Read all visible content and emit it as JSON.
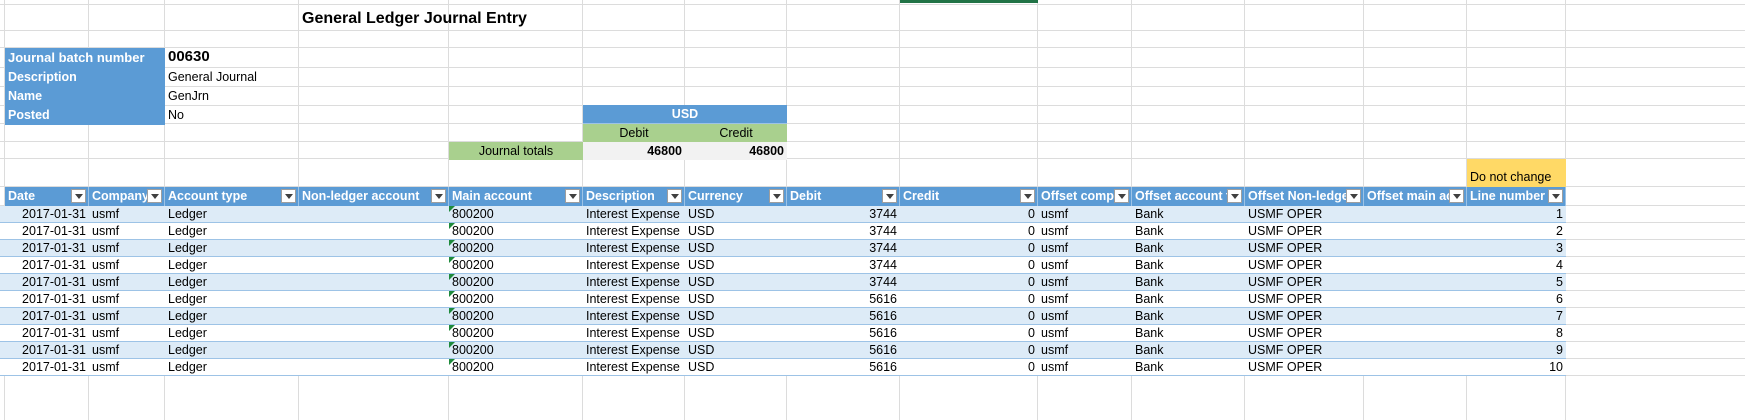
{
  "title": "General Ledger Journal Entry",
  "info": {
    "batch_label": "Journal batch number",
    "batch_value": "00630",
    "description_label": "Description",
    "description_value": "General Journal",
    "name_label": "Name",
    "name_value": "GenJrn",
    "posted_label": "Posted",
    "posted_value": "No"
  },
  "totals": {
    "currency": "USD",
    "debit_label": "Debit",
    "credit_label": "Credit",
    "row_label": "Journal totals",
    "debit_total": "46800",
    "credit_total": "46800"
  },
  "note": "Do not change",
  "columns": [
    "Date",
    "Company",
    "Account type",
    "Non-ledger account",
    "Main account",
    "Description",
    "Currency",
    "Debit",
    "Credit",
    "Offset compa",
    "Offset account ty",
    "Offset Non-ledger",
    "Offset main acc",
    "Line number"
  ],
  "rows": [
    {
      "date": "2017-01-31",
      "company": "usmf",
      "account_type": "Ledger",
      "non_ledger": "",
      "main_account": "800200",
      "description": "Interest Expense",
      "currency": "USD",
      "debit": "3744",
      "credit": "0",
      "offset_company": "usmf",
      "offset_type": "Bank",
      "offset_nonledger": "USMF OPER",
      "offset_main": "",
      "line": "1"
    },
    {
      "date": "2017-01-31",
      "company": "usmf",
      "account_type": "Ledger",
      "non_ledger": "",
      "main_account": "800200",
      "description": "Interest Expense",
      "currency": "USD",
      "debit": "3744",
      "credit": "0",
      "offset_company": "usmf",
      "offset_type": "Bank",
      "offset_nonledger": "USMF OPER",
      "offset_main": "",
      "line": "2"
    },
    {
      "date": "2017-01-31",
      "company": "usmf",
      "account_type": "Ledger",
      "non_ledger": "",
      "main_account": "800200",
      "description": "Interest Expense",
      "currency": "USD",
      "debit": "3744",
      "credit": "0",
      "offset_company": "usmf",
      "offset_type": "Bank",
      "offset_nonledger": "USMF OPER",
      "offset_main": "",
      "line": "3"
    },
    {
      "date": "2017-01-31",
      "company": "usmf",
      "account_type": "Ledger",
      "non_ledger": "",
      "main_account": "800200",
      "description": "Interest Expense",
      "currency": "USD",
      "debit": "3744",
      "credit": "0",
      "offset_company": "usmf",
      "offset_type": "Bank",
      "offset_nonledger": "USMF OPER",
      "offset_main": "",
      "line": "4"
    },
    {
      "date": "2017-01-31",
      "company": "usmf",
      "account_type": "Ledger",
      "non_ledger": "",
      "main_account": "800200",
      "description": "Interest Expense",
      "currency": "USD",
      "debit": "3744",
      "credit": "0",
      "offset_company": "usmf",
      "offset_type": "Bank",
      "offset_nonledger": "USMF OPER",
      "offset_main": "",
      "line": "5"
    },
    {
      "date": "2017-01-31",
      "company": "usmf",
      "account_type": "Ledger",
      "non_ledger": "",
      "main_account": "800200",
      "description": "Interest Expense",
      "currency": "USD",
      "debit": "5616",
      "credit": "0",
      "offset_company": "usmf",
      "offset_type": "Bank",
      "offset_nonledger": "USMF OPER",
      "offset_main": "",
      "line": "6"
    },
    {
      "date": "2017-01-31",
      "company": "usmf",
      "account_type": "Ledger",
      "non_ledger": "",
      "main_account": "800200",
      "description": "Interest Expense",
      "currency": "USD",
      "debit": "5616",
      "credit": "0",
      "offset_company": "usmf",
      "offset_type": "Bank",
      "offset_nonledger": "USMF OPER",
      "offset_main": "",
      "line": "7"
    },
    {
      "date": "2017-01-31",
      "company": "usmf",
      "account_type": "Ledger",
      "non_ledger": "",
      "main_account": "800200",
      "description": "Interest Expense",
      "currency": "USD",
      "debit": "5616",
      "credit": "0",
      "offset_company": "usmf",
      "offset_type": "Bank",
      "offset_nonledger": "USMF OPER",
      "offset_main": "",
      "line": "8"
    },
    {
      "date": "2017-01-31",
      "company": "usmf",
      "account_type": "Ledger",
      "non_ledger": "",
      "main_account": "800200",
      "description": "Interest Expense",
      "currency": "USD",
      "debit": "5616",
      "credit": "0",
      "offset_company": "usmf",
      "offset_type": "Bank",
      "offset_nonledger": "USMF OPER",
      "offset_main": "",
      "line": "9"
    },
    {
      "date": "2017-01-31",
      "company": "usmf",
      "account_type": "Ledger",
      "non_ledger": "",
      "main_account": "800200",
      "description": "Interest Expense",
      "currency": "USD",
      "debit": "5616",
      "credit": "0",
      "offset_company": "usmf",
      "offset_type": "Bank",
      "offset_nonledger": "USMF OPER",
      "offset_main": "",
      "line": "10"
    }
  ],
  "colors": {
    "header_blue": "#5b9bd5",
    "band_blue": "#ddebf7",
    "green": "#a9d08e",
    "yellow": "#ffd966",
    "gray": "#f2f2f2"
  }
}
